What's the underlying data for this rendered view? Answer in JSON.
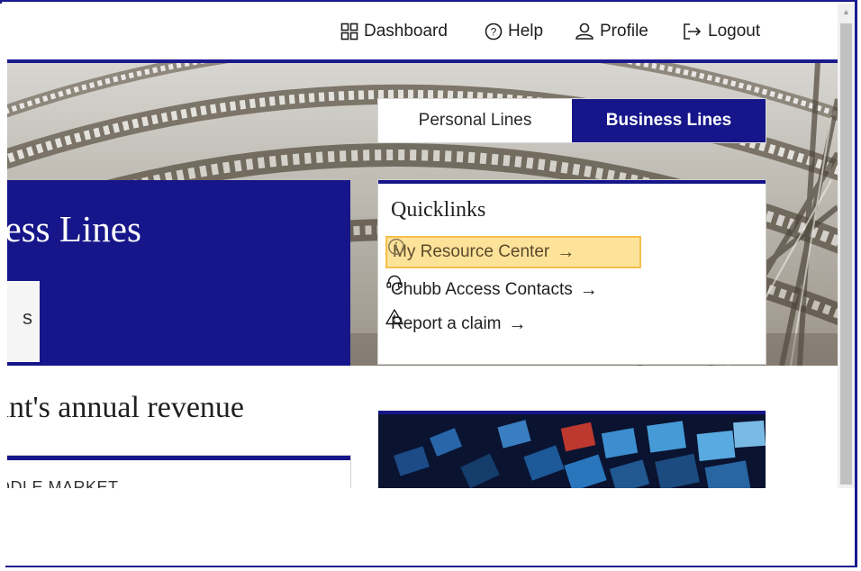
{
  "nav": {
    "dashboard": "Dashboard",
    "help": "Help",
    "profile": "Profile",
    "logout": "Logout"
  },
  "toggle": {
    "personal": "Personal Lines",
    "business": "Business Lines",
    "selected": "Business Lines"
  },
  "hero": {
    "title": "ness Lines",
    "sub_tab": "s"
  },
  "quicklinks": {
    "title": "Quicklinks",
    "links": [
      {
        "label": "My Resource Center",
        "icon": "info-circle-icon",
        "highlighted": true
      },
      {
        "label": "Chubb Access Contacts",
        "icon": "headset-icon",
        "highlighted": false
      },
      {
        "label": "Report a claim",
        "icon": "warning-icon",
        "highlighted": false
      }
    ],
    "arrow": "→"
  },
  "section": {
    "heading": "unt's annual revenue",
    "card_label": "DDLE MARKET"
  },
  "colors": {
    "brand_navy": "#16168a",
    "highlight": "#fde29a",
    "highlight_border": "#f5c04a"
  }
}
